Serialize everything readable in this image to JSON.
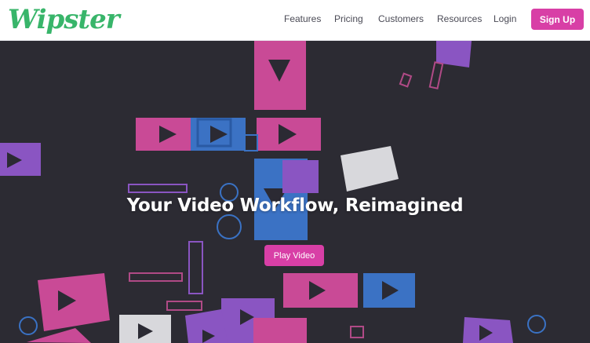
{
  "brand": {
    "logo_text": "Wipster",
    "accent": "#d83fa6",
    "logo_color": "#38b56a"
  },
  "nav": {
    "features": "Features",
    "pricing": "Pricing",
    "customers": "Customers",
    "resources": "Resources",
    "login": "Login",
    "signup": "Sign Up"
  },
  "hero": {
    "headline": "Your Video Workflow, Reimagined",
    "play_button": "Play Video",
    "palette": {
      "pink": "#c94a96",
      "blue": "#3b72c4",
      "purple": "#8a55c2",
      "grey": "#d8d8dc",
      "outline_blue": "#3a72c4",
      "outline_pink": "#b04a86"
    }
  }
}
